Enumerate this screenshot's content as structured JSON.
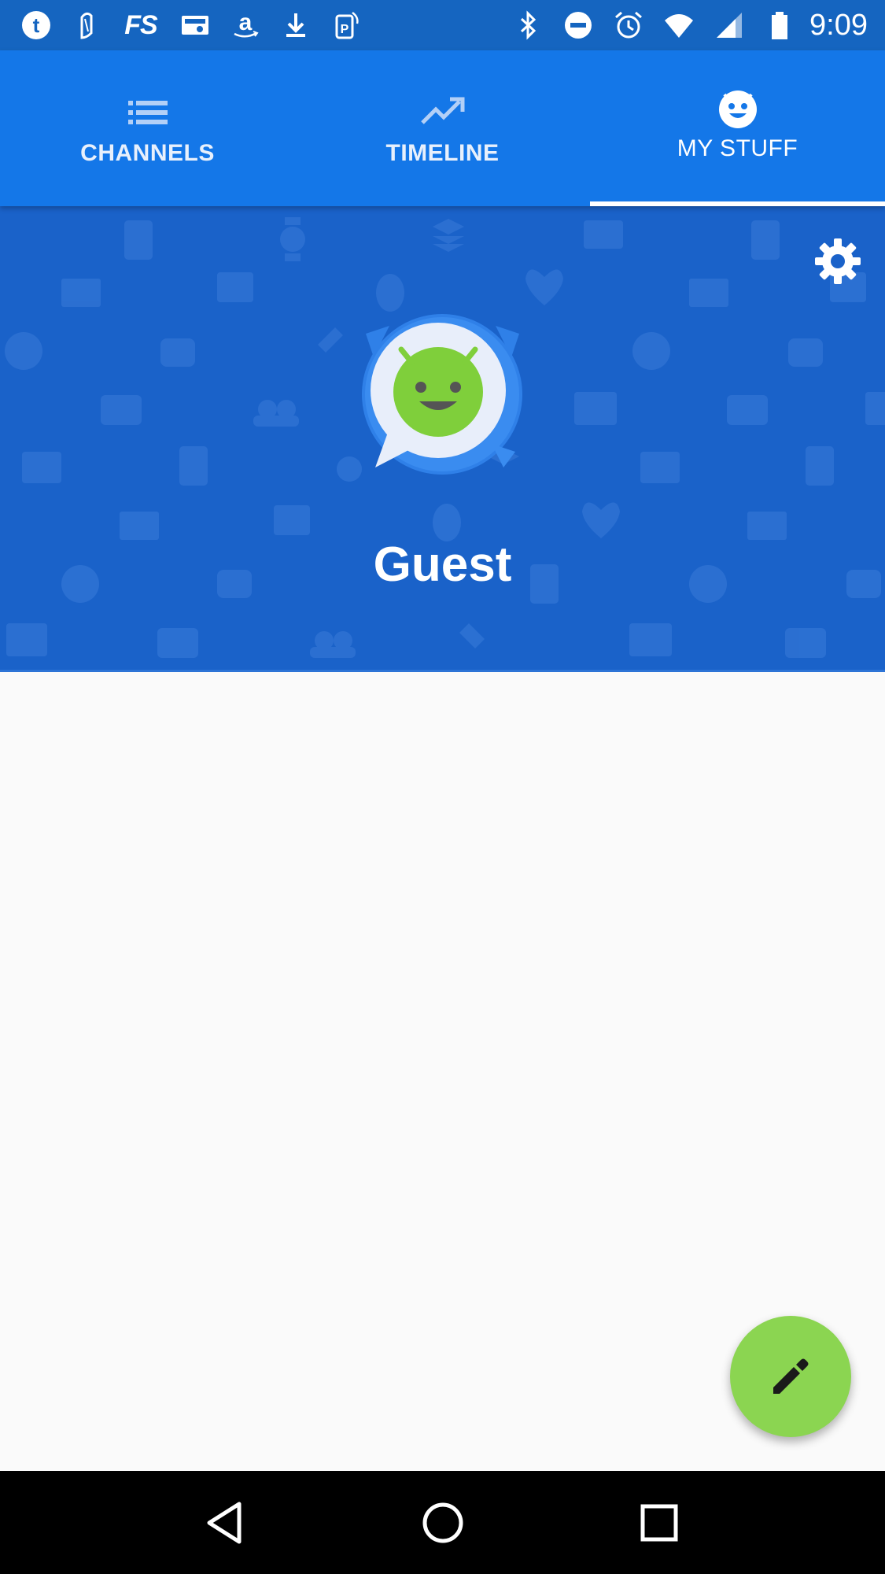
{
  "status_bar": {
    "left_icons": [
      "tumblr-icon",
      "quill-icon",
      "fs-icon",
      "photos-icon",
      "amazon-icon",
      "download-icon",
      "parking-icon"
    ],
    "fs_label": "FS",
    "right_icons": [
      "bluetooth-icon",
      "do-not-disturb-icon",
      "alarm-icon",
      "wifi-icon",
      "cell-signal-icon",
      "battery-icon"
    ],
    "time": "9:09"
  },
  "tabs": [
    {
      "label": "CHANNELS",
      "icon": "list-icon",
      "active": false
    },
    {
      "label": "TIMELINE",
      "icon": "trending-up-icon",
      "active": false
    },
    {
      "label": "MY STUFF",
      "icon": "smiley-robot-icon",
      "active": true
    }
  ],
  "profile": {
    "name": "Guest",
    "avatar_icon": "robot-chat-avatar"
  },
  "fab": {
    "icon": "pencil-icon"
  },
  "nav": {
    "icons": [
      "back-icon",
      "home-icon",
      "recents-icon"
    ]
  },
  "colors": {
    "status_bar": "#1565c0",
    "tab_bar": "#1477e8",
    "header": "#1a62c9",
    "fab": "#8bd551",
    "robot_green": "#7fcf3b"
  }
}
